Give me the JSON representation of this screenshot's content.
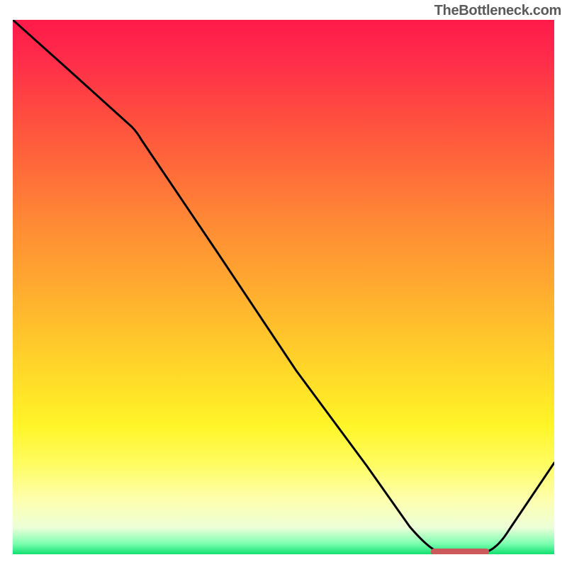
{
  "watermark": "TheBottleneck.com",
  "chart_data": {
    "type": "line",
    "title": "",
    "xlabel": "",
    "ylabel": "",
    "xlim": [
      0,
      100
    ],
    "ylim": [
      0,
      100
    ],
    "series": [
      {
        "name": "bottleneck-curve",
        "x": [
          0,
          10,
          22,
          35,
          50,
          65,
          75,
          80,
          84,
          90,
          100
        ],
        "y": [
          100,
          91,
          80,
          60,
          38,
          17,
          3,
          0,
          0,
          5,
          17
        ]
      }
    ],
    "marker": {
      "x_start": 77,
      "x_end": 88,
      "color": "#cc5a5a"
    },
    "gradient_stops": [
      {
        "pos": 0.0,
        "color": "#ff1a4a"
      },
      {
        "pos": 0.5,
        "color": "#ffc22c"
      },
      {
        "pos": 0.8,
        "color": "#fffc60"
      },
      {
        "pos": 1.0,
        "color": "#10e070"
      }
    ]
  }
}
